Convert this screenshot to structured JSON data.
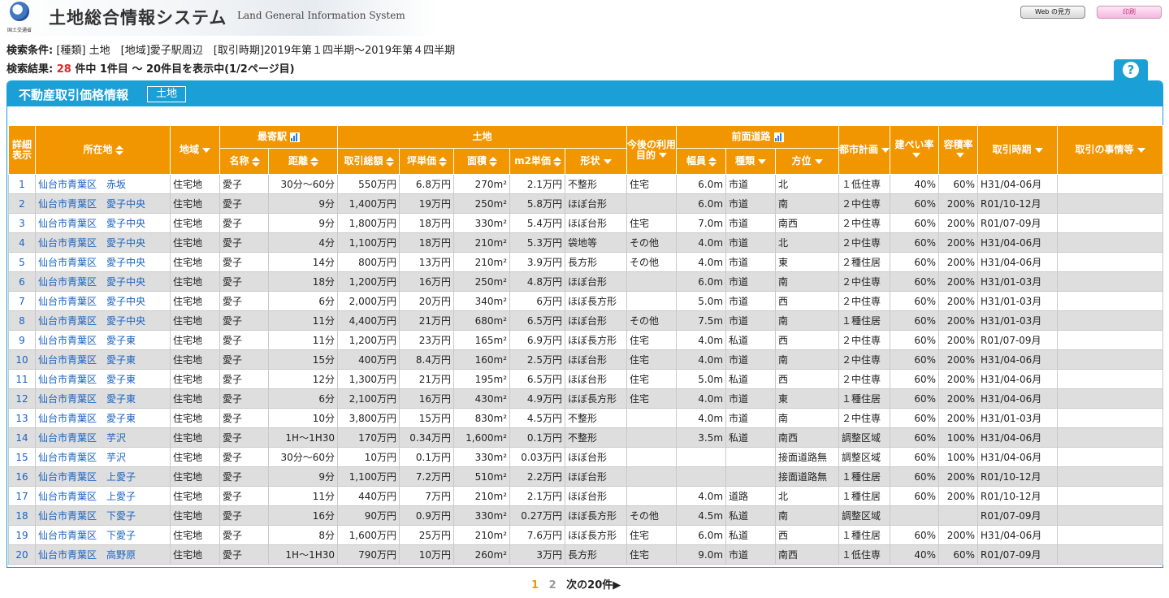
{
  "header": {
    "logo_text": "国土交通省",
    "title": "土地総合情報システム",
    "subtitle": "Land General Information System",
    "web_help_button": "Web の見方",
    "print_button": "印刷"
  },
  "search": {
    "conditions_label": "検索条件:",
    "conditions": "[種類] 土地　[地域]愛子駅周辺　[取引時期]2019年第１四半期～2019年第４四半期",
    "result_label": "検索結果:",
    "result_count": "28",
    "result_text": "件中 1件目 ～ 20件目を表示中(1/2ページ目)"
  },
  "help_icon": "question-icon",
  "panel": {
    "title": "不動産取引価格情報",
    "tag": "土地"
  },
  "table": {
    "headers": {
      "detail": "詳細表示",
      "location": "所在地",
      "area_type": "地域",
      "station_group": "最寄駅",
      "station_name": "名称",
      "station_distance": "距離",
      "land_group": "土地",
      "total_price": "取引総額",
      "tsubo_price": "坪単価",
      "area": "面積",
      "sqm_price": "m2単価",
      "shape": "形状",
      "future_use": "今後の利用目的",
      "road_group": "前面道路",
      "road_width": "幅員",
      "road_type": "種類",
      "road_direction": "方位",
      "city_plan": "都市計画",
      "coverage": "建ぺい率",
      "floor_ratio": "容積率",
      "period": "取引時期",
      "circumstances": "取引の事情等"
    },
    "rows": [
      {
        "no": "1",
        "loc": "仙台市青葉区　赤坂",
        "type": "住宅地",
        "st": "愛子",
        "dist": "30分～60分",
        "total": "550万円",
        "tsubo": "6.8万円",
        "area": "270m²",
        "sqm": "2.1万円",
        "shape": "不整形",
        "use": "住宅",
        "width": "6.0m",
        "road": "市道",
        "dir": "北",
        "plan": "１低住専",
        "cov": "40%",
        "far": "60%",
        "period": "H31/04-06月",
        "note": ""
      },
      {
        "no": "2",
        "loc": "仙台市青葉区　愛子中央",
        "type": "住宅地",
        "st": "愛子",
        "dist": "9分",
        "total": "1,400万円",
        "tsubo": "19万円",
        "area": "250m²",
        "sqm": "5.8万円",
        "shape": "ほぼ台形",
        "use": "",
        "width": "6.0m",
        "road": "市道",
        "dir": "南",
        "plan": "２中住専",
        "cov": "60%",
        "far": "200%",
        "period": "R01/10-12月",
        "note": ""
      },
      {
        "no": "3",
        "loc": "仙台市青葉区　愛子中央",
        "type": "住宅地",
        "st": "愛子",
        "dist": "9分",
        "total": "1,800万円",
        "tsubo": "18万円",
        "area": "330m²",
        "sqm": "5.4万円",
        "shape": "ほぼ台形",
        "use": "住宅",
        "width": "7.0m",
        "road": "市道",
        "dir": "南西",
        "plan": "２中住専",
        "cov": "60%",
        "far": "200%",
        "period": "R01/07-09月",
        "note": ""
      },
      {
        "no": "4",
        "loc": "仙台市青葉区　愛子中央",
        "type": "住宅地",
        "st": "愛子",
        "dist": "4分",
        "total": "1,100万円",
        "tsubo": "18万円",
        "area": "210m²",
        "sqm": "5.3万円",
        "shape": "袋地等",
        "use": "その他",
        "width": "4.0m",
        "road": "市道",
        "dir": "北",
        "plan": "２中住専",
        "cov": "60%",
        "far": "200%",
        "period": "H31/04-06月",
        "note": ""
      },
      {
        "no": "5",
        "loc": "仙台市青葉区　愛子中央",
        "type": "住宅地",
        "st": "愛子",
        "dist": "14分",
        "total": "800万円",
        "tsubo": "13万円",
        "area": "210m²",
        "sqm": "3.9万円",
        "shape": "長方形",
        "use": "その他",
        "width": "4.0m",
        "road": "市道",
        "dir": "東",
        "plan": "２種住居",
        "cov": "60%",
        "far": "200%",
        "period": "H31/04-06月",
        "note": ""
      },
      {
        "no": "6",
        "loc": "仙台市青葉区　愛子中央",
        "type": "住宅地",
        "st": "愛子",
        "dist": "18分",
        "total": "1,200万円",
        "tsubo": "16万円",
        "area": "250m²",
        "sqm": "4.8万円",
        "shape": "ほぼ台形",
        "use": "",
        "width": "6.0m",
        "road": "市道",
        "dir": "南",
        "plan": "２中住専",
        "cov": "60%",
        "far": "200%",
        "period": "H31/01-03月",
        "note": ""
      },
      {
        "no": "7",
        "loc": "仙台市青葉区　愛子中央",
        "type": "住宅地",
        "st": "愛子",
        "dist": "6分",
        "total": "2,000万円",
        "tsubo": "20万円",
        "area": "340m²",
        "sqm": "6万円",
        "shape": "ほぼ長方形",
        "use": "",
        "width": "5.0m",
        "road": "市道",
        "dir": "西",
        "plan": "２中住専",
        "cov": "60%",
        "far": "200%",
        "period": "H31/01-03月",
        "note": ""
      },
      {
        "no": "8",
        "loc": "仙台市青葉区　愛子中央",
        "type": "住宅地",
        "st": "愛子",
        "dist": "11分",
        "total": "4,400万円",
        "tsubo": "21万円",
        "area": "680m²",
        "sqm": "6.5万円",
        "shape": "ほぼ台形",
        "use": "その他",
        "width": "7.5m",
        "road": "市道",
        "dir": "南",
        "plan": "１種住居",
        "cov": "60%",
        "far": "200%",
        "period": "H31/01-03月",
        "note": ""
      },
      {
        "no": "9",
        "loc": "仙台市青葉区　愛子東",
        "type": "住宅地",
        "st": "愛子",
        "dist": "11分",
        "total": "1,200万円",
        "tsubo": "23万円",
        "area": "165m²",
        "sqm": "6.9万円",
        "shape": "ほぼ長方形",
        "use": "住宅",
        "width": "4.0m",
        "road": "私道",
        "dir": "西",
        "plan": "２中住専",
        "cov": "60%",
        "far": "200%",
        "period": "R01/07-09月",
        "note": ""
      },
      {
        "no": "10",
        "loc": "仙台市青葉区　愛子東",
        "type": "住宅地",
        "st": "愛子",
        "dist": "15分",
        "total": "400万円",
        "tsubo": "8.4万円",
        "area": "160m²",
        "sqm": "2.5万円",
        "shape": "ほぼ台形",
        "use": "住宅",
        "width": "4.0m",
        "road": "市道",
        "dir": "南",
        "plan": "２中住専",
        "cov": "60%",
        "far": "200%",
        "period": "H31/04-06月",
        "note": ""
      },
      {
        "no": "11",
        "loc": "仙台市青葉区　愛子東",
        "type": "住宅地",
        "st": "愛子",
        "dist": "12分",
        "total": "1,300万円",
        "tsubo": "21万円",
        "area": "195m²",
        "sqm": "6.5万円",
        "shape": "ほぼ台形",
        "use": "住宅",
        "width": "5.0m",
        "road": "私道",
        "dir": "西",
        "plan": "２中住専",
        "cov": "60%",
        "far": "200%",
        "period": "H31/04-06月",
        "note": ""
      },
      {
        "no": "12",
        "loc": "仙台市青葉区　愛子東",
        "type": "住宅地",
        "st": "愛子",
        "dist": "6分",
        "total": "2,100万円",
        "tsubo": "16万円",
        "area": "430m²",
        "sqm": "4.9万円",
        "shape": "ほぼ長方形",
        "use": "住宅",
        "width": "4.0m",
        "road": "市道",
        "dir": "東",
        "plan": "１種住居",
        "cov": "60%",
        "far": "200%",
        "period": "H31/04-06月",
        "note": ""
      },
      {
        "no": "13",
        "loc": "仙台市青葉区　愛子東",
        "type": "住宅地",
        "st": "愛子",
        "dist": "10分",
        "total": "3,800万円",
        "tsubo": "15万円",
        "area": "830m²",
        "sqm": "4.5万円",
        "shape": "不整形",
        "use": "",
        "width": "4.0m",
        "road": "市道",
        "dir": "南",
        "plan": "２中住専",
        "cov": "60%",
        "far": "200%",
        "period": "H31/01-03月",
        "note": ""
      },
      {
        "no": "14",
        "loc": "仙台市青葉区　芋沢",
        "type": "住宅地",
        "st": "愛子",
        "dist": "1H～1H30",
        "total": "170万円",
        "tsubo": "0.34万円",
        "area": "1,600m²",
        "sqm": "0.1万円",
        "shape": "不整形",
        "use": "",
        "width": "3.5m",
        "road": "私道",
        "dir": "南西",
        "plan": "調整区域",
        "cov": "60%",
        "far": "100%",
        "period": "H31/04-06月",
        "note": ""
      },
      {
        "no": "15",
        "loc": "仙台市青葉区　芋沢",
        "type": "住宅地",
        "st": "愛子",
        "dist": "30分～60分",
        "total": "10万円",
        "tsubo": "0.1万円",
        "area": "330m²",
        "sqm": "0.03万円",
        "shape": "ほぼ台形",
        "use": "",
        "width": "",
        "road": "",
        "dir": "接面道路無",
        "plan": "調整区域",
        "cov": "60%",
        "far": "100%",
        "period": "H31/04-06月",
        "note": ""
      },
      {
        "no": "16",
        "loc": "仙台市青葉区　上愛子",
        "type": "住宅地",
        "st": "愛子",
        "dist": "9分",
        "total": "1,100万円",
        "tsubo": "7.2万円",
        "area": "510m²",
        "sqm": "2.2万円",
        "shape": "ほぼ台形",
        "use": "",
        "width": "",
        "road": "",
        "dir": "接面道路無",
        "plan": "１種住居",
        "cov": "60%",
        "far": "200%",
        "period": "R01/10-12月",
        "note": ""
      },
      {
        "no": "17",
        "loc": "仙台市青葉区　上愛子",
        "type": "住宅地",
        "st": "愛子",
        "dist": "11分",
        "total": "440万円",
        "tsubo": "7万円",
        "area": "210m²",
        "sqm": "2.1万円",
        "shape": "ほぼ台形",
        "use": "",
        "width": "4.0m",
        "road": "道路",
        "dir": "北",
        "plan": "１種住居",
        "cov": "60%",
        "far": "200%",
        "period": "R01/10-12月",
        "note": ""
      },
      {
        "no": "18",
        "loc": "仙台市青葉区　下愛子",
        "type": "住宅地",
        "st": "愛子",
        "dist": "16分",
        "total": "90万円",
        "tsubo": "0.9万円",
        "area": "330m²",
        "sqm": "0.27万円",
        "shape": "ほぼ長方形",
        "use": "その他",
        "width": "4.5m",
        "road": "私道",
        "dir": "南",
        "plan": "調整区域",
        "cov": "",
        "far": "",
        "period": "R01/07-09月",
        "note": ""
      },
      {
        "no": "19",
        "loc": "仙台市青葉区　下愛子",
        "type": "住宅地",
        "st": "愛子",
        "dist": "8分",
        "total": "1,600万円",
        "tsubo": "25万円",
        "area": "210m²",
        "sqm": "7.6万円",
        "shape": "ほぼ長方形",
        "use": "住宅",
        "width": "6.0m",
        "road": "私道",
        "dir": "西",
        "plan": "１種住居",
        "cov": "60%",
        "far": "200%",
        "period": "H31/04-06月",
        "note": ""
      },
      {
        "no": "20",
        "loc": "仙台市青葉区　高野原",
        "type": "住宅地",
        "st": "愛子",
        "dist": "1H～1H30",
        "total": "790万円",
        "tsubo": "10万円",
        "area": "260m²",
        "sqm": "3万円",
        "shape": "長方形",
        "use": "住宅",
        "width": "9.0m",
        "road": "市道",
        "dir": "南西",
        "plan": "１低住専",
        "cov": "40%",
        "far": "60%",
        "period": "R01/07-09月",
        "note": ""
      }
    ]
  },
  "pager": {
    "page1": "1",
    "page2": "2",
    "next": "次の20件▶"
  }
}
